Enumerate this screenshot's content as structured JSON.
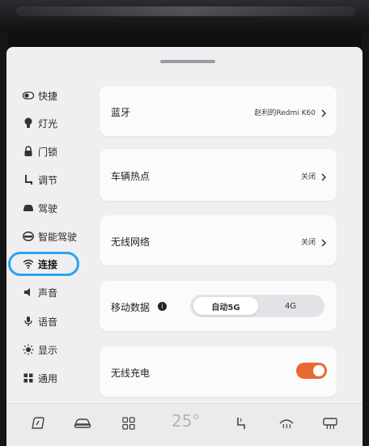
{
  "sidebar": {
    "items": [
      {
        "label": "快捷",
        "icon": "toggle-icon"
      },
      {
        "label": "灯光",
        "icon": "bulb-icon"
      },
      {
        "label": "门锁",
        "icon": "lock-icon"
      },
      {
        "label": "调节",
        "icon": "seat-adjust-icon"
      },
      {
        "label": "驾驶",
        "icon": "car-icon"
      },
      {
        "label": "智能驾驶",
        "icon": "steering-wheel-icon"
      },
      {
        "label": "连接",
        "icon": "wifi-icon",
        "active": true
      },
      {
        "label": "声音",
        "icon": "speaker-icon"
      },
      {
        "label": "语音",
        "icon": "microphone-icon"
      },
      {
        "label": "显示",
        "icon": "brightness-icon"
      },
      {
        "label": "通用",
        "icon": "grid-icon"
      }
    ]
  },
  "cards": {
    "bluetooth": {
      "title": "蓝牙",
      "value": "赵利的Redmi K60"
    },
    "hotspot": {
      "title": "车辆热点",
      "value": "关闭"
    },
    "wifi": {
      "title": "无线网络",
      "value": "关闭"
    },
    "mobile_data": {
      "title": "移动数据",
      "options": [
        "自动5G",
        "4G"
      ],
      "selected": "自动5G"
    },
    "wireless_charging": {
      "title": "无线充电",
      "enabled": true
    }
  },
  "dock": {
    "temperature": "25°",
    "items": [
      "home-icon",
      "car-icon",
      "apps-icon",
      "seat-heat-icon",
      "front-defrost-icon",
      "rear-defrost-icon"
    ]
  },
  "colors": {
    "accent": "#e8692f",
    "highlight_ring": "#2aa3f0"
  }
}
